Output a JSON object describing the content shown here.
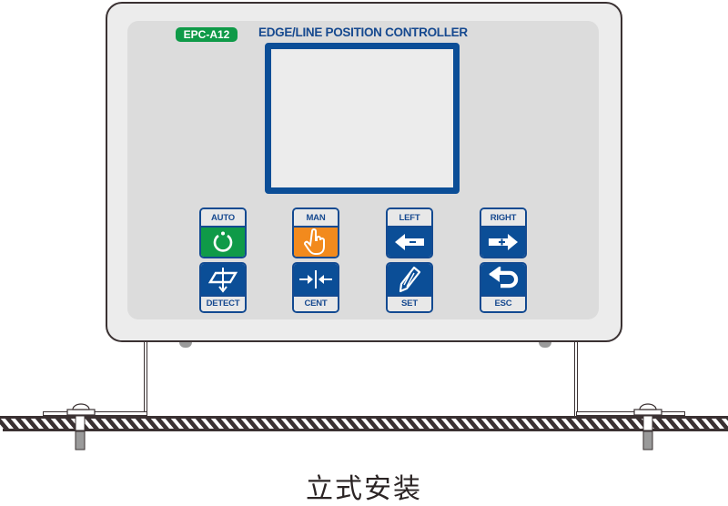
{
  "device": {
    "model": "EPC-A12",
    "title": "EDGE/LINE POSITION CONTROLLER",
    "colors": {
      "brand_blue": "#0b4e97",
      "auto_green": "#0f9a48",
      "man_orange": "#f28a1d",
      "badge_green": "#0f9a48"
    }
  },
  "keys_top": [
    {
      "label": "AUTO",
      "icon": "power-ring-icon",
      "color": "#0f9a48"
    },
    {
      "label": "MAN",
      "icon": "hand-pointer-icon",
      "color": "#f28a1d"
    },
    {
      "label": "LEFT",
      "icon": "arrow-left-minus-icon",
      "color": "#0b4e97"
    },
    {
      "label": "RIGHT",
      "icon": "arrow-right-plus-icon",
      "color": "#0b4e97"
    }
  ],
  "keys_bottom": [
    {
      "label": "DETECT",
      "icon": "detect-sensor-icon"
    },
    {
      "label": "CENT",
      "icon": "center-arrows-icon"
    },
    {
      "label": "SET",
      "icon": "pencil-icon"
    },
    {
      "label": "ESC",
      "icon": "return-arrow-icon"
    }
  ],
  "caption": "立式安装"
}
